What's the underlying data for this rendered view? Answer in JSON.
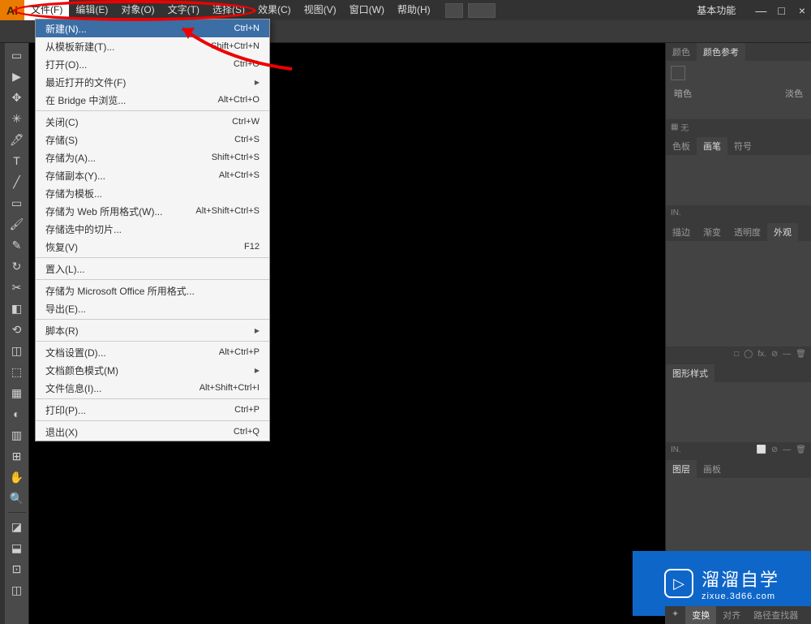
{
  "app_icon": "Ai",
  "menubar": [
    "文件(F)",
    "编辑(E)",
    "对象(O)",
    "文字(T)",
    "选择(S)",
    "效果(C)",
    "视图(V)",
    "窗口(W)",
    "帮助(H)"
  ],
  "workspace": "基本功能",
  "window_buttons": {
    "min": "—",
    "max": "□",
    "close": "×"
  },
  "dropdown": {
    "groups": [
      [
        {
          "label": "新建(N)...",
          "shortcut": "Ctrl+N",
          "hl": true
        },
        {
          "label": "从模板新建(T)...",
          "shortcut": "Shift+Ctrl+N"
        },
        {
          "label": "打开(O)...",
          "shortcut": "Ctrl+O"
        },
        {
          "label": "最近打开的文件(F)",
          "shortcut": "",
          "arrow": true
        },
        {
          "label": "在 Bridge 中浏览...",
          "shortcut": "Alt+Ctrl+O"
        }
      ],
      [
        {
          "label": "关闭(C)",
          "shortcut": "Ctrl+W"
        },
        {
          "label": "存储(S)",
          "shortcut": "Ctrl+S"
        },
        {
          "label": "存储为(A)...",
          "shortcut": "Shift+Ctrl+S"
        },
        {
          "label": "存储副本(Y)...",
          "shortcut": "Alt+Ctrl+S"
        },
        {
          "label": "存储为模板...",
          "shortcut": ""
        },
        {
          "label": "存储为 Web 所用格式(W)...",
          "shortcut": "Alt+Shift+Ctrl+S"
        },
        {
          "label": "存储选中的切片...",
          "shortcut": ""
        },
        {
          "label": "恢复(V)",
          "shortcut": "F12"
        }
      ],
      [
        {
          "label": "置入(L)...",
          "shortcut": ""
        }
      ],
      [
        {
          "label": "存储为 Microsoft Office 所用格式...",
          "shortcut": ""
        },
        {
          "label": "导出(E)...",
          "shortcut": ""
        }
      ],
      [
        {
          "label": "脚本(R)",
          "shortcut": "",
          "arrow": true
        }
      ],
      [
        {
          "label": "文档设置(D)...",
          "shortcut": "Alt+Ctrl+P"
        },
        {
          "label": "文档颜色模式(M)",
          "shortcut": "",
          "arrow": true
        },
        {
          "label": "文件信息(I)...",
          "shortcut": "Alt+Shift+Ctrl+I"
        }
      ],
      [
        {
          "label": "打印(P)...",
          "shortcut": "Ctrl+P"
        }
      ],
      [
        {
          "label": "退出(X)",
          "shortcut": "Ctrl+Q"
        }
      ]
    ]
  },
  "tools": [
    "▭",
    "▶",
    "✥",
    "✳",
    "🖋",
    "T",
    "╱",
    "▭",
    "🖌",
    "✎",
    "↻",
    "✂",
    "◧",
    "⟲",
    "◫",
    "⬚",
    "▦",
    "◐",
    "▥",
    "⊞",
    "✋",
    "🔍"
  ],
  "tool_lower": [
    "◪",
    "⬓",
    "⊡",
    "◫"
  ],
  "panels": {
    "color": {
      "tabs": [
        "颜色",
        "颜色参考"
      ],
      "active": 1,
      "dark": "暗色",
      "light": "淡色",
      "foot_icon": "▦",
      "foot_label": "无"
    },
    "brush": {
      "tabs": [
        "色板",
        "画笔",
        "符号"
      ],
      "active": 1,
      "foot": "IN."
    },
    "appearance": {
      "tabs": [
        "描边",
        "渐变",
        "透明度",
        "外观"
      ],
      "active": 3,
      "foot_r": [
        "□",
        "◯",
        "fx.",
        "⊘",
        "—",
        "🗑"
      ]
    },
    "graphicstyle": {
      "tabs": [
        "图形样式"
      ],
      "active": 0,
      "foot": "IN.",
      "foot_r": [
        "⬜",
        "⊘",
        "—",
        "🗑"
      ]
    },
    "layers": {
      "tabs": [
        "图层",
        "画板"
      ],
      "active": 0
    }
  },
  "bottom_tabs": [
    "✦",
    "变换",
    "对齐",
    "路径查找器"
  ],
  "watermark": {
    "big": "溜溜自学",
    "small": "zixue.3d66.com",
    "icon": "▷"
  }
}
